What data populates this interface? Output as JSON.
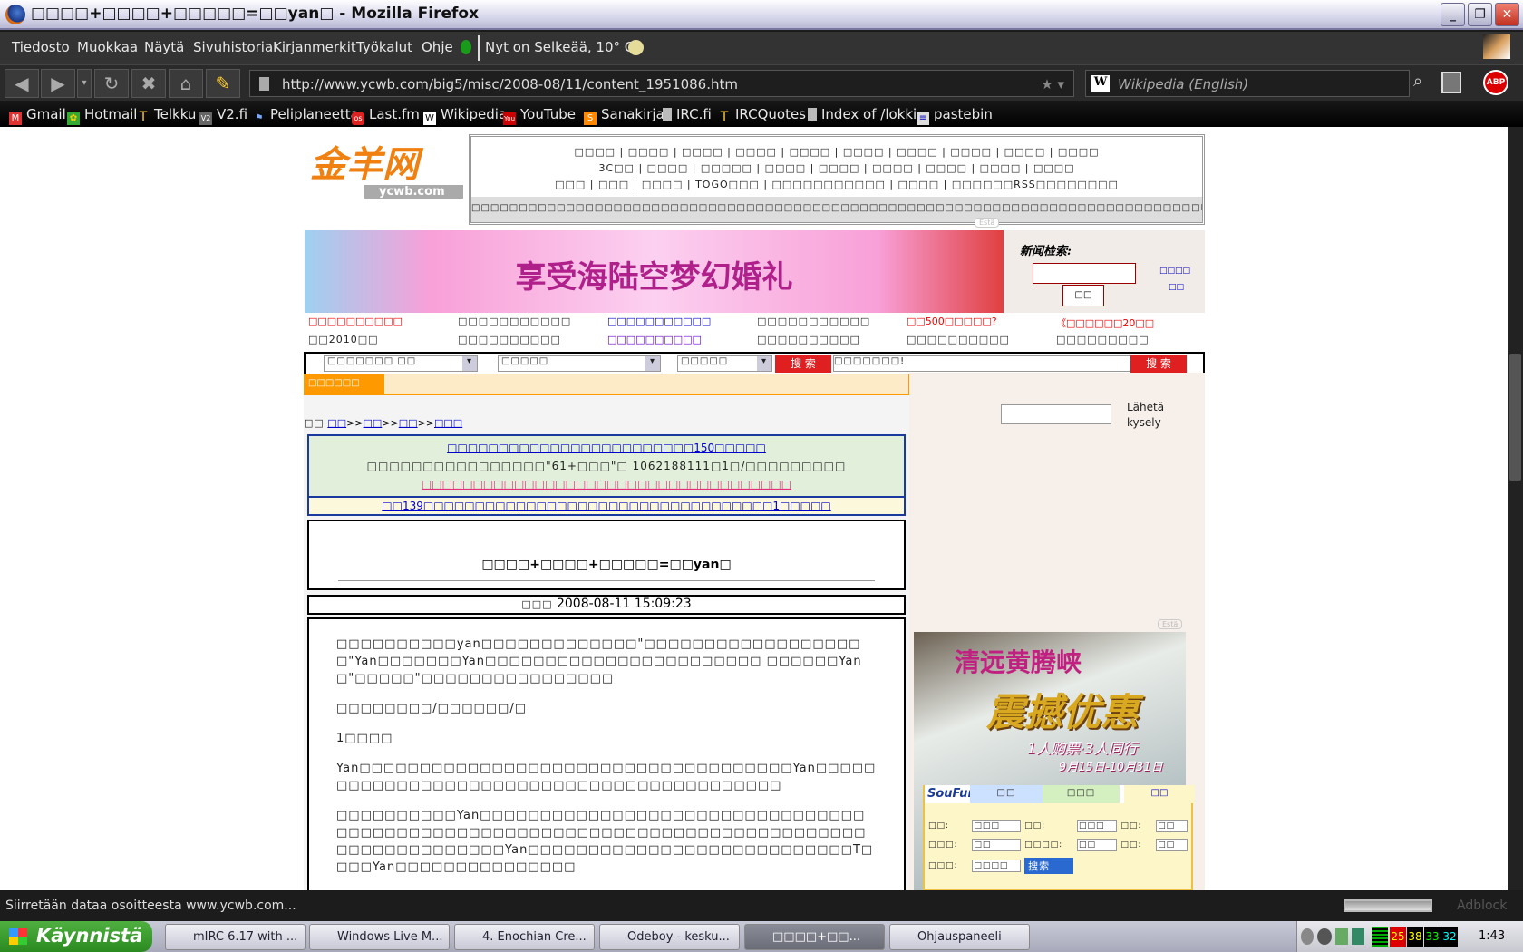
{
  "window": {
    "title": "□□□□+□□□□+□□□□□=□□yan□ - Mozilla Firefox",
    "min": "_",
    "max": "❐",
    "close": "✕"
  },
  "menu": [
    "Tiedosto",
    "Muokkaa",
    "Näytä",
    "Sivuhistoria",
    "Kirjanmerkit",
    "Työkalut",
    "Ohje"
  ],
  "weather": "Nyt on Selkeää, 10° C",
  "nav": {
    "url": "http://www.ycwb.com/big5/misc/2008-08/11/content_1951086.htm",
    "search_placeholder": "Wikipedia (English)",
    "abp": "ABP"
  },
  "bookmarks": [
    "Gmail",
    "Hotmail",
    "Telkku",
    "V2.fi",
    "Peliplaneetta",
    "Last.fm",
    "Wikipedia",
    "YouTube",
    "Sanakirja",
    "IRC.fi",
    "IRCQuotes",
    "Index of /lokki",
    "pastebin"
  ],
  "page": {
    "logo": "金羊网",
    "logo_sub": "ycwb.com",
    "toplinks": [
      "□□□□ | □□□□ | □□□□ | □□□□ | □□□□ | □□□□ | □□□□ | □□□□ | □□□□ | □□□□",
      "3C□□ | □□□□ | □□□□□ | □□□□ | □□□□ | □□□□ | □□□□ | □□□□ | □□□□",
      "□□□ | □□□ | □□□□ | TOGO□□□ | □□□□□□□□□□□ | □□□□ | □□□□□□RSS□□□□□□□□"
    ],
    "ticker": "□□□□□□□□□□□□□□□□□□□□□□□□□□□□□□□□□□□□□□□□□□□□□□□□□□□□□□□□□□□□□□□□□□□□□□□□□□□□□E□□",
    "esta": "Estä",
    "banner": "享受海陆空梦幻婚礼",
    "news_search_label": "新闻检索:",
    "news_search_btn": "□□",
    "news_side": "□□□□",
    "news_side2": "□□",
    "links": [
      "□□□□□□□□□□",
      "□□□□□□□□□□□",
      "□□□□□□□□□□□",
      "□□□□□□□□□□□",
      "□□500□□□□□?",
      "《□□□□□□20□□",
      "□□2010□□",
      "□□□□□□□□□□",
      "□□□□□□□□□□",
      "□□□□□□□□□□",
      "□□□□□□□□□□",
      "□□□□□□□□□"
    ],
    "search_selects": [
      "□□□□□□□ □□",
      "□□□□□",
      "□□□□□"
    ],
    "search_btn": "搜 索",
    "search_text": "□□□□□□□!",
    "section": "□□□□□□",
    "breadcrumb": [
      "□□",
      "□□",
      ">>",
      "□□",
      ">>",
      "□□",
      ">>",
      "□□□"
    ],
    "promo": [
      "□□□□□□□□□□□□□□□□□□□□□□□□150□□□□□",
      "□□□□□□□□□□□□□□□□\"61+□□□\"□ 1062188111□1□/□□□□□□□□□",
      "□□□□□□□□□□□□□□□□□□□□□□□□□□□□□□□□□□□□",
      "□□139□□□□□□□□□□□□□□□□□□□□□□□□□□□□□□□□□□1□□□□□"
    ],
    "article_title": "□□□□+□□□□+□□□□□=□□yan□",
    "date_label": "□□□",
    "date": "2008-08-11 15:09:23",
    "paragraphs": [
      "□□□□□□□□□□yan□□□□□□□□□□□□□\"□□□□□□□□□□□□□□□□□□□\"Yan□□□□□□□Yan□□□□□□□□□□□□□□□□□□□□□□□ □□□□□□Yan□\"□□□□□\"□□□□□□□□□□□□□□□□",
      "□□□□□□□□/□□□□□□/□",
      "1□□□□",
      "Yan□□□□□□□□□□□□□□□□□□□□□□□□□□□□□□□□□□□□Yan□□□□□□□□□□□□□□□□□□□□□□□□□□□□□□□□□□□□□□□□□□",
      "□□□□□□□□□□Yan□□□□□□□□□□□□□□□□□□□□□□□□□□□□□□□□□□□□□□□□□□□□□□□□□□□□□□□□□□□□□□□□□□□□□□□□□□□□□□□□□□□□□□□□□□Yan□□□□□□□□□□□□□□□□□□□□□□□□□□□T□□□□Yan□□□□□□□□□□□□□□□"
    ],
    "side_send": "Lähetä kysely",
    "ad_title": "清远黄腾峡",
    "ad_big": "震撼优惠",
    "ad_sub": "1人购票·3人同行",
    "ad_date": "9月15日-10月31日",
    "soufun": "SouFun",
    "soufun_tabs": [
      "□□",
      "□□□",
      "□□"
    ],
    "soufun_fields": [
      "□□:",
      "□□□",
      "□□:",
      "□□□",
      "□□:",
      "□□",
      "□□□:",
      "□□",
      "□□□□:",
      "□□",
      "□□:",
      "□□",
      "□□□:",
      "□□□□"
    ],
    "soufun_btn": "搜索"
  },
  "status": "Siirretään dataa osoitteesta www.ycwb.com...",
  "adblock": "Adblock",
  "taskbar": {
    "start": "Käynnistä",
    "tasks": [
      "mIRC 6.17 with ...",
      "Windows Live M...",
      "4. Enochian Cre...",
      "Odeboy - kesku...",
      "□□□□+□□...",
      "Ohjauspaneeli"
    ],
    "tray_nums": [
      "25",
      "38",
      "33",
      "32"
    ],
    "clock": "1:43"
  }
}
